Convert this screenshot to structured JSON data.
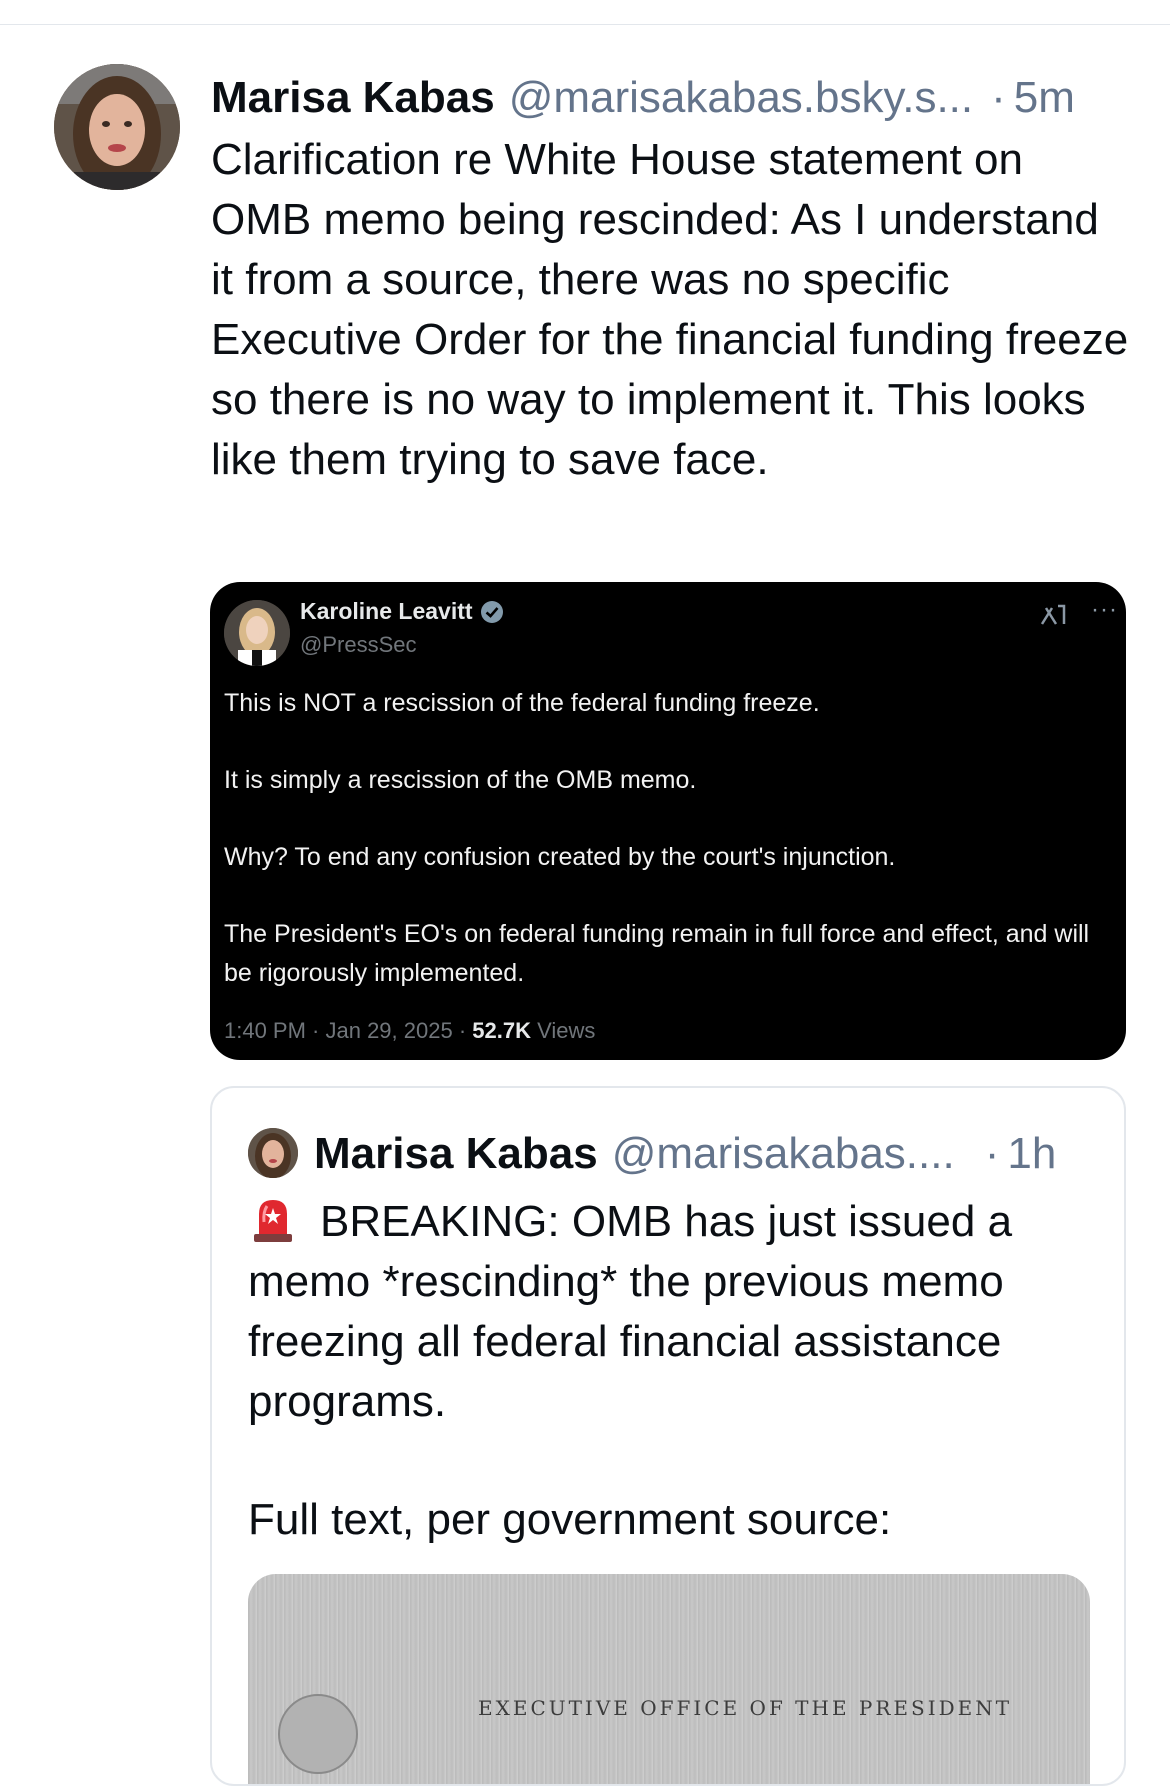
{
  "post": {
    "author_name": "Marisa Kabas",
    "author_handle": "@marisakabas.bsky.s...",
    "separator": "·",
    "time": "5m",
    "text": "Clarification re White House statement on OMB memo being rescinded: As I understand it from a source, there was no specific Executive Order for the financial funding freeze so there is no way to implement it. This looks like them trying to save face."
  },
  "embedded_screenshot": {
    "author_name": "Karoline Leavitt",
    "author_handle": "@PressSec",
    "more": "···",
    "paragraphs": [
      "This is NOT a rescission of the federal funding freeze.",
      "It is simply a rescission of the OMB memo.",
      "Why? To end any confusion created by the court's injunction.",
      "The President's EO's on federal funding remain in full force and effect, and will be rigorously implemented."
    ],
    "timestamp": "1:40 PM · Jan 29, 2025 · ",
    "views_count": "52.7K",
    "views_label": " Views"
  },
  "quoted_post": {
    "author_name": "Marisa Kabas",
    "author_handle": "@marisakabas....",
    "separator": "·",
    "time": "1h",
    "text": "BREAKING: OMB has just issued a memo *rescinding* the previous memo freezing all federal financial assistance programs.",
    "text2": "Full text, per government source:",
    "image_caption": "EXECUTIVE OFFICE OF THE PRESIDENT"
  },
  "colors": {
    "text": "#0b0f14",
    "muted": "#64748b",
    "divider": "#e3e7ec",
    "x_background": "#000000",
    "verified": "#829aab"
  },
  "icons": [
    "avatar",
    "verified-badge-icon",
    "grok-icon",
    "more-icon",
    "siren-emoji-icon"
  ]
}
